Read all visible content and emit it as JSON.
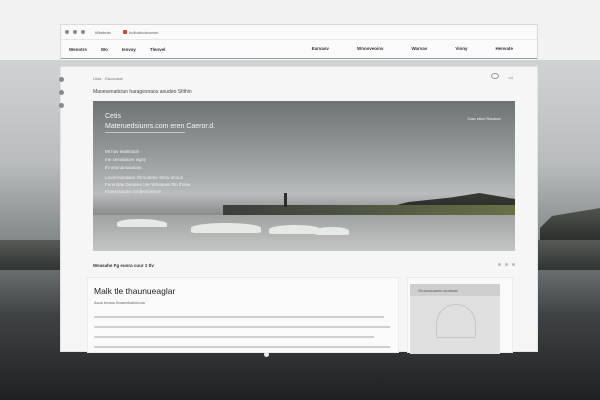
{
  "browser": {
    "tab_label": "Wlmbuto",
    "url_text": "Indbuttudsnowm"
  },
  "navbar": {
    "left_items": [
      "Wenotrs",
      "Wo",
      "Ienvay",
      "Tlenvel"
    ],
    "right_items": [
      "Earvasv",
      "Wnosveoinv",
      "Warvav",
      "Viony",
      "Henvate"
    ]
  },
  "page": {
    "topline": "Uloa  · Gacvusiat",
    "help_label": "ad",
    "subheading": "Maoesenaticiun haragesnaos aoudeo Sfithin"
  },
  "hero": {
    "title": "Cetis",
    "subtitle": "Materuedsiunrs.com eren Caeror.d.",
    "lines_group1": [
      "Mt hav easttnaos",
      "me smnalaioer wgsy",
      "thi asonansauioan"
    ],
    "lines_group2": [
      "Lrenernaoaaso Ilnroodebe Shnu ahoun",
      "Ferendae Deaweo trer Weuauev tttu Ihoee",
      "Ftoeessaoan cnrdeonnenoe"
    ],
    "right_label": "Gaw etion Ranwov"
  },
  "caption": "Weasahe Fg euora cuur 1 tlv",
  "article": {
    "title": "Malk tle thaunueaglar",
    "meta": "Asus beaou fioawnfoaidvoos"
  },
  "sidecard": {
    "label": "Oruuodoanes ciudroat"
  }
}
